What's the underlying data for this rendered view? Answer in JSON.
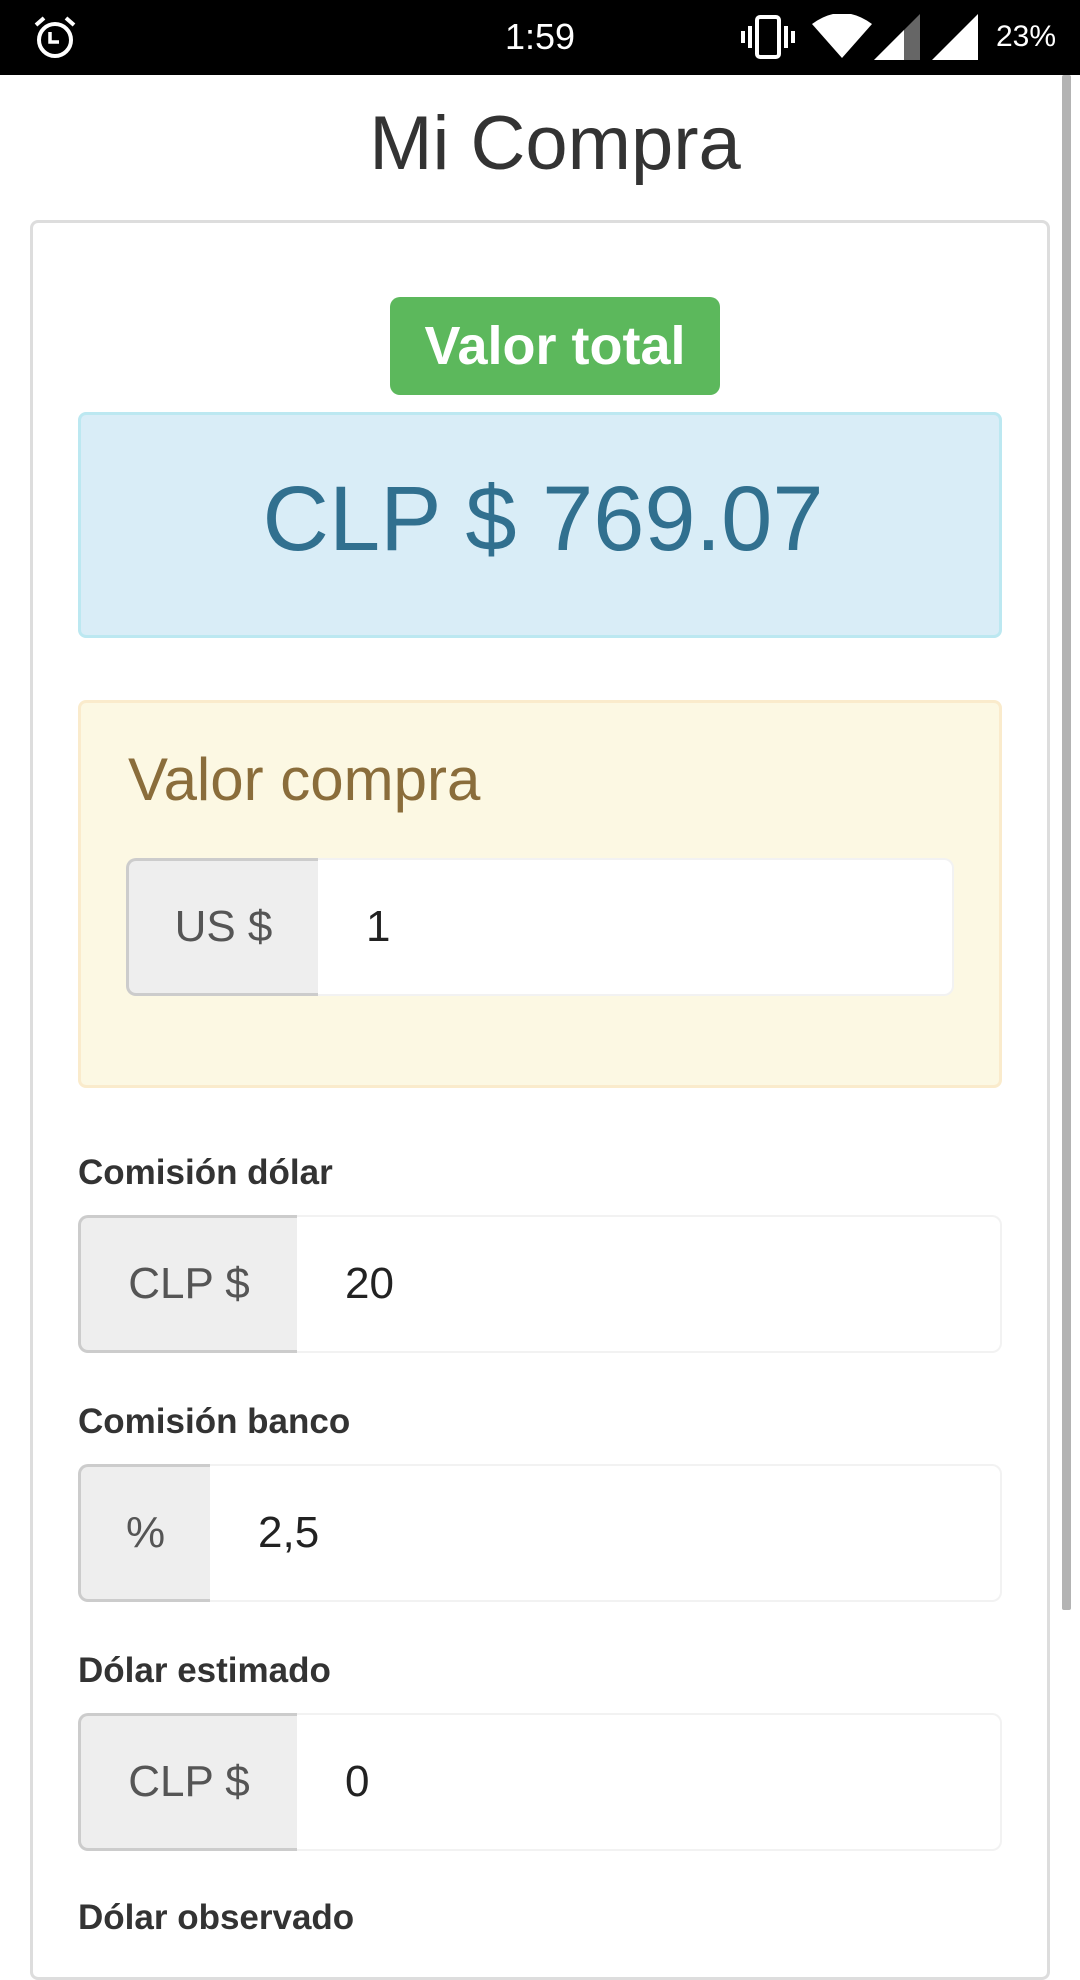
{
  "status_bar": {
    "time": "1:59",
    "battery": "23%"
  },
  "page": {
    "title": "Mi Compra"
  },
  "total": {
    "badge": "Valor total",
    "amount": "CLP $ 769.07"
  },
  "compra": {
    "heading": "Valor compra",
    "addon": "US $",
    "value": "1"
  },
  "fields": [
    {
      "label": "Comisión dólar",
      "addon": "CLP $",
      "value": "20"
    },
    {
      "label": "Comisión banco",
      "addon": "%",
      "value": "2,5"
    },
    {
      "label": "Dólar estimado",
      "addon": "CLP $",
      "value": "0"
    },
    {
      "label": "Dólar observado"
    }
  ],
  "colors": {
    "success": "#5cb85c",
    "info_bg": "#d9edf7",
    "info_text": "#31708f",
    "warning_bg": "#fcf8e3",
    "warning_text": "#8a6d3b"
  }
}
